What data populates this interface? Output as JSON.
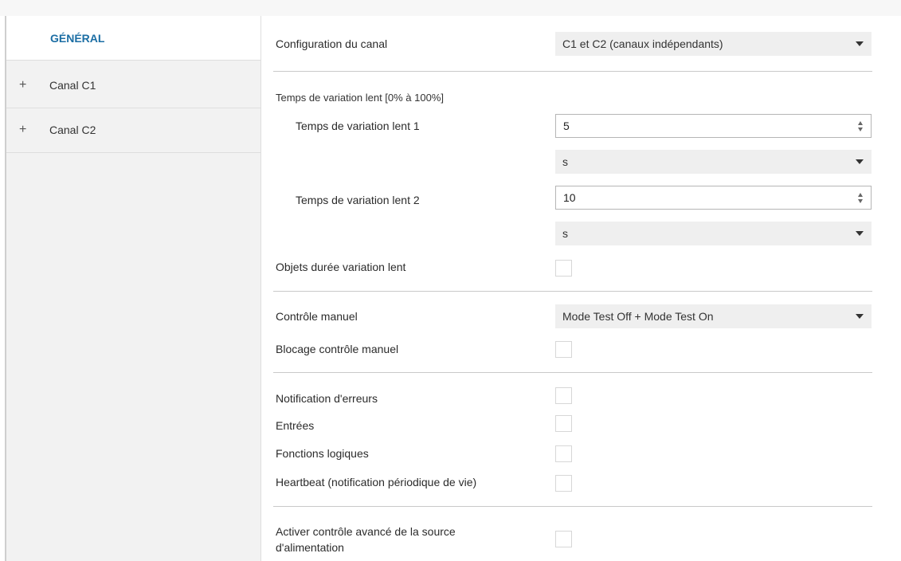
{
  "sidebar": {
    "items": [
      {
        "label": "GÉNÉRAL",
        "active": true
      },
      {
        "label": "Canal C1",
        "expander": "+"
      },
      {
        "label": "Canal C2",
        "expander": "+"
      }
    ]
  },
  "main": {
    "channel_config": {
      "label": "Configuration du canal",
      "value": "C1 et C2 (canaux indépendants)"
    },
    "slow_section": {
      "title": "Temps de variation lent [0% à 100%]"
    },
    "slow1": {
      "label": "Temps de variation lent 1",
      "value": "5",
      "unit": "s"
    },
    "slow2": {
      "label": "Temps de variation lent 2",
      "value": "10",
      "unit": "s"
    },
    "slow_objects": {
      "label": "Objets durée variation lent",
      "checked": false
    },
    "manual_control": {
      "label": "Contrôle manuel",
      "value": "Mode Test Off + Mode Test On"
    },
    "manual_lock": {
      "label": "Blocage contrôle manuel",
      "checked": false
    },
    "error_notif": {
      "label": "Notification d'erreurs",
      "checked": false
    },
    "inputs": {
      "label": "Entrées",
      "checked": false
    },
    "logic": {
      "label": "Fonctions logiques",
      "checked": false
    },
    "heartbeat": {
      "label": "Heartbeat (notification périodique de vie)",
      "checked": false
    },
    "power_source": {
      "label_line1": "Activer contrôle avancé de la source",
      "label_line2": "d'alimentation",
      "checked": false
    }
  },
  "colors": {
    "accent": "#1c6ea4",
    "sidebar_bg": "#f2f2f2",
    "dropdown_bg": "#efefef",
    "separator": "#c9c9c9"
  }
}
